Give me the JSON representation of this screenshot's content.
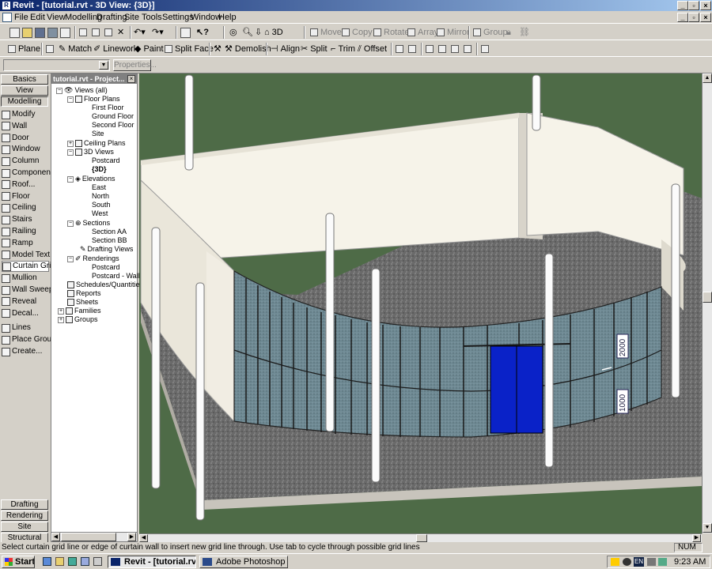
{
  "window": {
    "title": "Revit - [tutorial.rvt - 3D View: {3D}]"
  },
  "menu": [
    "File",
    "Edit",
    "View",
    "Modelling",
    "Drafting",
    "Site",
    "Tools",
    "Settings",
    "Window",
    "Help"
  ],
  "toolbar1": {
    "threed": "3D",
    "move": "Move",
    "copy": "Copy",
    "rotate": "Rotate",
    "array": "Array",
    "mirror": "Mirror",
    "group": "Group"
  },
  "toolbar2": {
    "plane": "Plane",
    "match": "Match",
    "linework": "Linework",
    "paint": "Paint",
    "split_face": "Split Face",
    "demolish": "Demolish",
    "align": "Align",
    "split": "Split",
    "trim": "Trim",
    "offset": "Offset"
  },
  "toolbar3": {
    "properties": "Properties..."
  },
  "tabs": {
    "basics": "Basics",
    "view": "View",
    "modelling": "Modelling",
    "drafting": "Drafting",
    "rendering": "Rendering",
    "site": "Site",
    "structural": "Structural"
  },
  "tools": [
    "Modify",
    "Wall",
    "Door",
    "Window",
    "Column",
    "Component",
    "Roof...",
    "Floor",
    "Ceiling",
    "Stairs",
    "Railing",
    "Ramp",
    "Model Text",
    "Curtain Grid",
    "Mullion",
    "Wall Sweep",
    "Reveal",
    "Decal...",
    "Lines",
    "Place Group",
    "Create..."
  ],
  "browser": {
    "title": "tutorial.rvt - Project...",
    "nodes": {
      "views": "Views (all)",
      "floor_plans": "Floor Plans",
      "first_floor": "First Floor",
      "ground_floor": "Ground Floor",
      "second_floor": "Second Floor",
      "site": "Site",
      "ceiling_plans": "Ceiling Plans",
      "views3d": "3D Views",
      "postcard": "Postcard",
      "view3d": "{3D}",
      "elevations": "Elevations",
      "east": "East",
      "north": "North",
      "south": "South",
      "west": "West",
      "sections": "Sections",
      "section_aa": "Section AA",
      "section_bb": "Section BB",
      "drafting_views": "Drafting Views",
      "renderings": "Renderings",
      "r_postcard": "Postcard",
      "r_postcard_wall": "Postcard - Wall",
      "schedules": "Schedules/Quantities",
      "reports": "Reports",
      "sheets": "Sheets",
      "families": "Families",
      "groups": "Groups"
    }
  },
  "viewport": {
    "dim_upper": "2000",
    "dim_lower": "1000"
  },
  "status": {
    "message": "Select curtain grid line or edge of curtain wall to insert new grid line through.  Use tab to cycle through possible grid lines",
    "num": "NUM"
  },
  "taskbar": {
    "start": "Start",
    "task_revit": "Revit - [tutorial.rvt ...",
    "task_photoshop": "Adobe Photoshop",
    "lang": "EN",
    "time": "9:23 AM"
  }
}
